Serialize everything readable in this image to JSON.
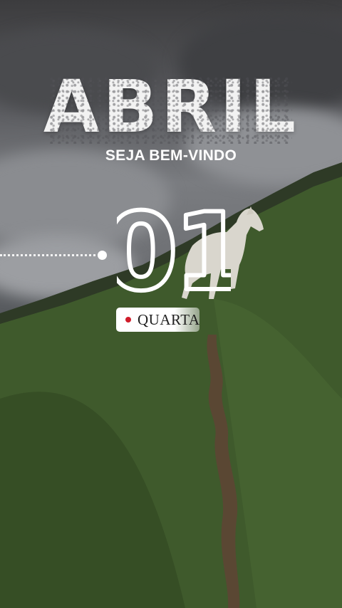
{
  "story": {
    "month": "ABRIL",
    "greeting": "SEJA BEM-VINDO",
    "day_number": "01",
    "weekday": "QUARTA"
  },
  "colors": {
    "text": "#ffffff",
    "weekday_bullet": "#d01c2a",
    "grass": "#3f5a2c",
    "sky": "#6f7175"
  }
}
